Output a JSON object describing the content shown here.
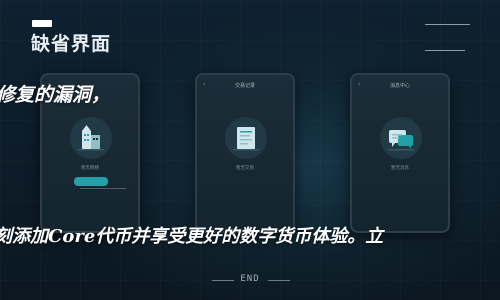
{
  "header": {
    "title": "缺省界面"
  },
  "overlay": {
    "line_top": "修复的漏洞，",
    "line_bottom": "刻添加Core代币并享受更好的数字货币体验。立"
  },
  "screens": [
    {
      "header": "",
      "caption": "暂无网络",
      "icon": "building-icon"
    },
    {
      "header": "交易记录",
      "caption": "暂无交易",
      "icon": "document-icon"
    },
    {
      "header": "消息中心",
      "caption": "暂无消息",
      "icon": "message-icon"
    }
  ],
  "footer": {
    "end_label": "END"
  },
  "colors": {
    "background": "#0c1b26",
    "phone": "#1b2d38",
    "accent": "#24a1a8"
  }
}
